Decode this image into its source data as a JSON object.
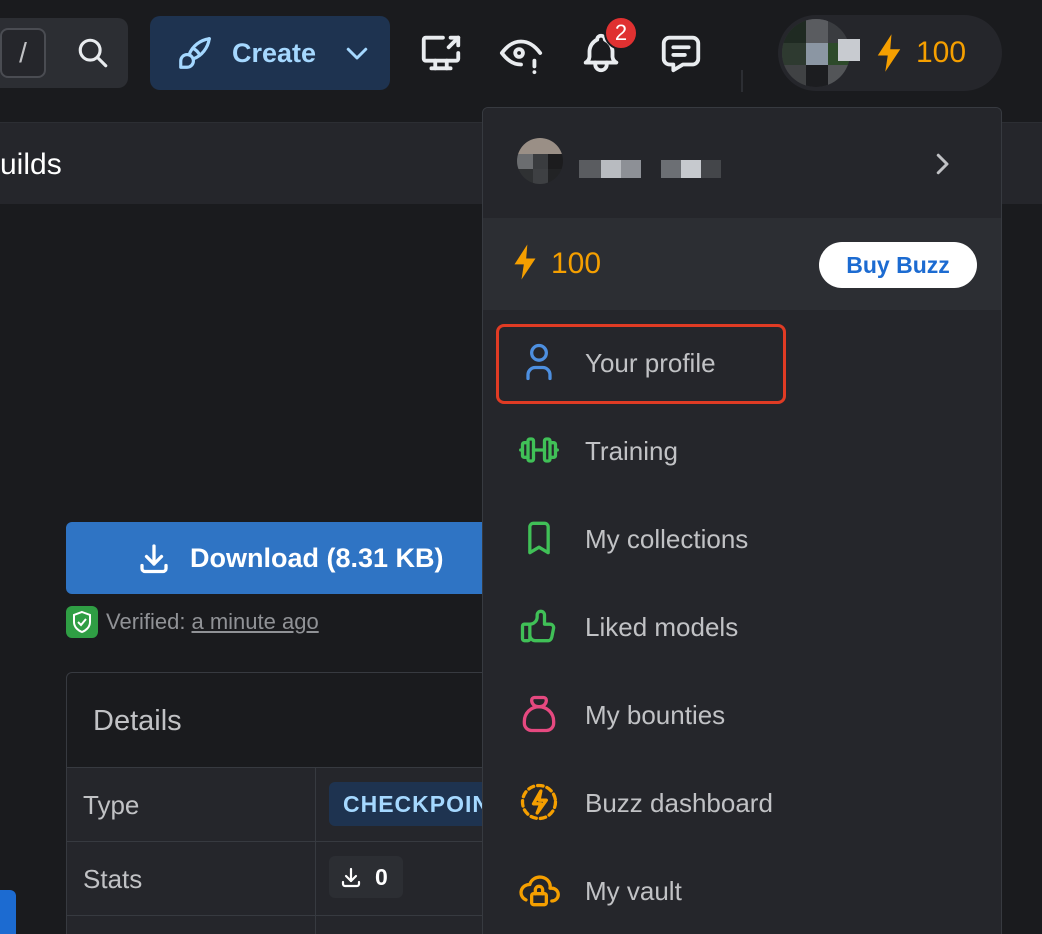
{
  "header": {
    "search_shortcut": "/",
    "create_label": "Create",
    "notification_count": "2",
    "buzz_amount": "100"
  },
  "subbar": {
    "title": "uilds"
  },
  "download": {
    "label": "Download (8.31 KB)"
  },
  "verified": {
    "label": "Verified:",
    "time": "a minute ago"
  },
  "details": {
    "title": "Details",
    "rows": [
      {
        "label": "Type",
        "value": "CHECKPOINT"
      },
      {
        "label": "Stats",
        "value": "0"
      }
    ]
  },
  "dropdown": {
    "buzz_amount": "100",
    "buy_label": "Buy Buzz",
    "items": [
      {
        "label": "Your profile",
        "icon": "user-icon",
        "color": "#4d8fe0"
      },
      {
        "label": "Training",
        "icon": "barbell-icon",
        "color": "#40c057"
      },
      {
        "label": "My collections",
        "icon": "bookmark-icon",
        "color": "#40c057"
      },
      {
        "label": "Liked models",
        "icon": "thumb-up-icon",
        "color": "#40c057"
      },
      {
        "label": "My bounties",
        "icon": "moneybag-icon",
        "color": "#e64980"
      },
      {
        "label": "Buzz dashboard",
        "icon": "bolt-circle-icon",
        "color": "#f59f00"
      },
      {
        "label": "My vault",
        "icon": "cloud-lock-icon",
        "color": "#f59f00"
      }
    ]
  },
  "colors": {
    "accent": "#2f74c4",
    "buzz": "#f59f00",
    "highlight": "#e03b24"
  }
}
